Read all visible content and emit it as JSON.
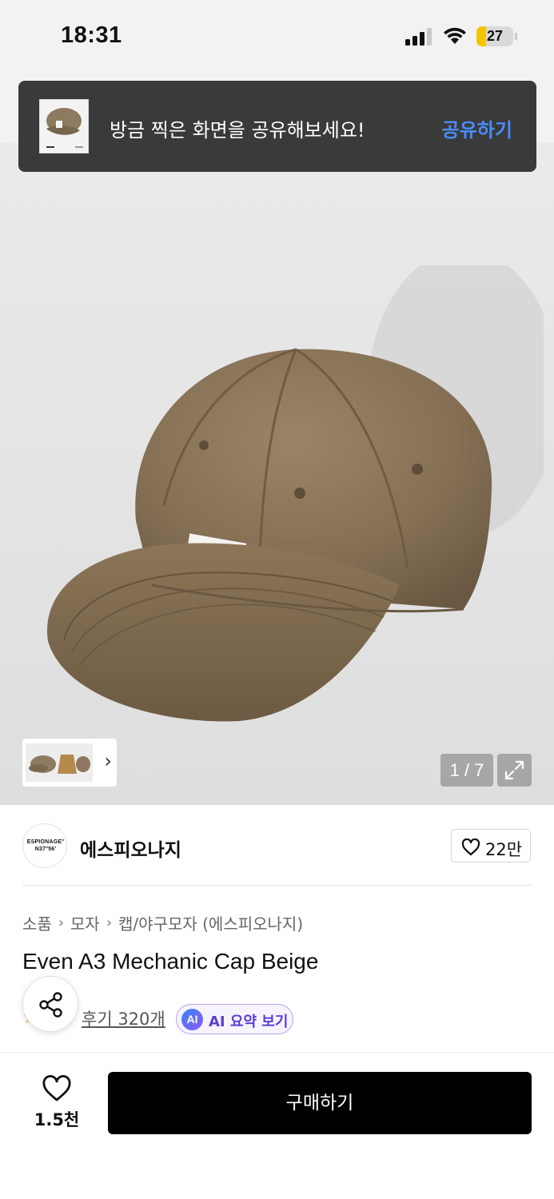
{
  "status_bar": {
    "time": "18:31",
    "battery_level": "27",
    "battery_fraction": 0.27,
    "icons": [
      "signal-icon",
      "wifi-icon",
      "battery-icon"
    ]
  },
  "toast": {
    "message": "방금 찍은 화면을 공유해보세요!",
    "action_label": "공유하기"
  },
  "gallery": {
    "current": "1 / 7",
    "expand_icon": "expand-icon",
    "thumbnail_next_icon": "chevron-right-icon"
  },
  "brand": {
    "logo_text": "ESPIONAGE° N37°56'",
    "name": "에스피오나지",
    "like_count": "22만"
  },
  "breadcrumb": {
    "items": [
      "소품",
      "모자",
      "캡/야구모자 (에스피오나지)"
    ]
  },
  "product": {
    "title": "Even A3 Mechanic Cap Beige",
    "review_label": "후기 320개",
    "ai_badge": "AI",
    "ai_summary_label": "AI 요약 보기"
  },
  "bottom_bar": {
    "like_count": "1.5천",
    "buy_label": "구매하기"
  },
  "colors": {
    "toast_bg": "#3a3a3a",
    "toast_action": "#4a8cff",
    "buy_button": "#000000",
    "ai_accent": "#5b3fd1",
    "cap": "#8a7356"
  }
}
